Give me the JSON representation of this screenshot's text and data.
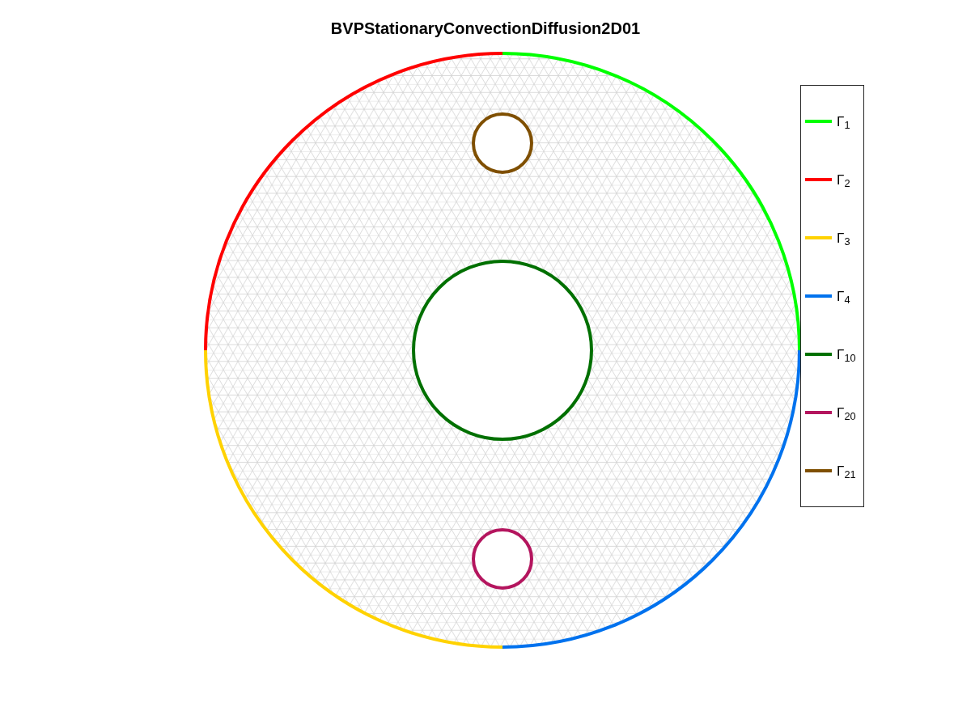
{
  "title": "BVPStationaryConvectionDiffusion2D01",
  "boundaries": [
    {
      "label": "Γ$_{1}$",
      "color": "#00ff00",
      "kind": "outer-arc"
    },
    {
      "label": "Γ$_{2}$",
      "color": "#ff0000",
      "kind": "outer-arc"
    },
    {
      "label": "Γ$_{3}$",
      "color": "#ffd200",
      "kind": "outer-arc"
    },
    {
      "label": "Γ$_{4}$",
      "color": "#0072ee",
      "kind": "outer-arc"
    },
    {
      "label": "Γ$_{10}$",
      "color": "#007000",
      "kind": "hole"
    },
    {
      "label": "Γ$_{20}$",
      "color": "#b4155e",
      "kind": "hole"
    },
    {
      "label": "Γ$_{21}$",
      "color": "#7f4f00",
      "kind": "hole"
    }
  ]
}
